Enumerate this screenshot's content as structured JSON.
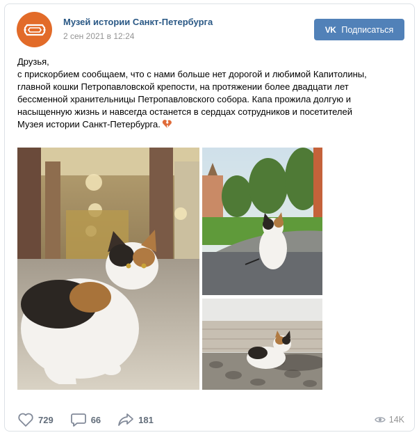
{
  "post": {
    "author": "Музей истории Санкт-Петербурга",
    "date": "2 сен 2021 в 12:24",
    "subscribe_label": "Подписаться",
    "subscribe_logo": "VK",
    "text_lines": [
      "Друзья,",
      "с прискорбием сообщаем, что с нами больше нет дорогой и любимой Капитолины,",
      "главной кошки Петропавловской крепости, на протяжении более двадцати лет",
      "бессменной хранительницы Петропавловского собора. Капа прожила долгую и",
      "насыщенную жизнь и навсегда останется в сердцах сотрудников и посетителей",
      "Музея истории Санкт-Петербурга."
    ],
    "emoji": "broken-heart-icon",
    "photos": [
      "cathedral-interior-cat-photo",
      "cat-on-pavement-photo",
      "cat-on-cobblestones-photo"
    ]
  },
  "actions": {
    "likes": "729",
    "comments": "66",
    "shares": "181",
    "views": "14K"
  },
  "colors": {
    "link": "#2a5885",
    "button": "#5181b8",
    "avatar": "#e26b29",
    "muted": "#939393",
    "action_text": "#626d7a"
  }
}
